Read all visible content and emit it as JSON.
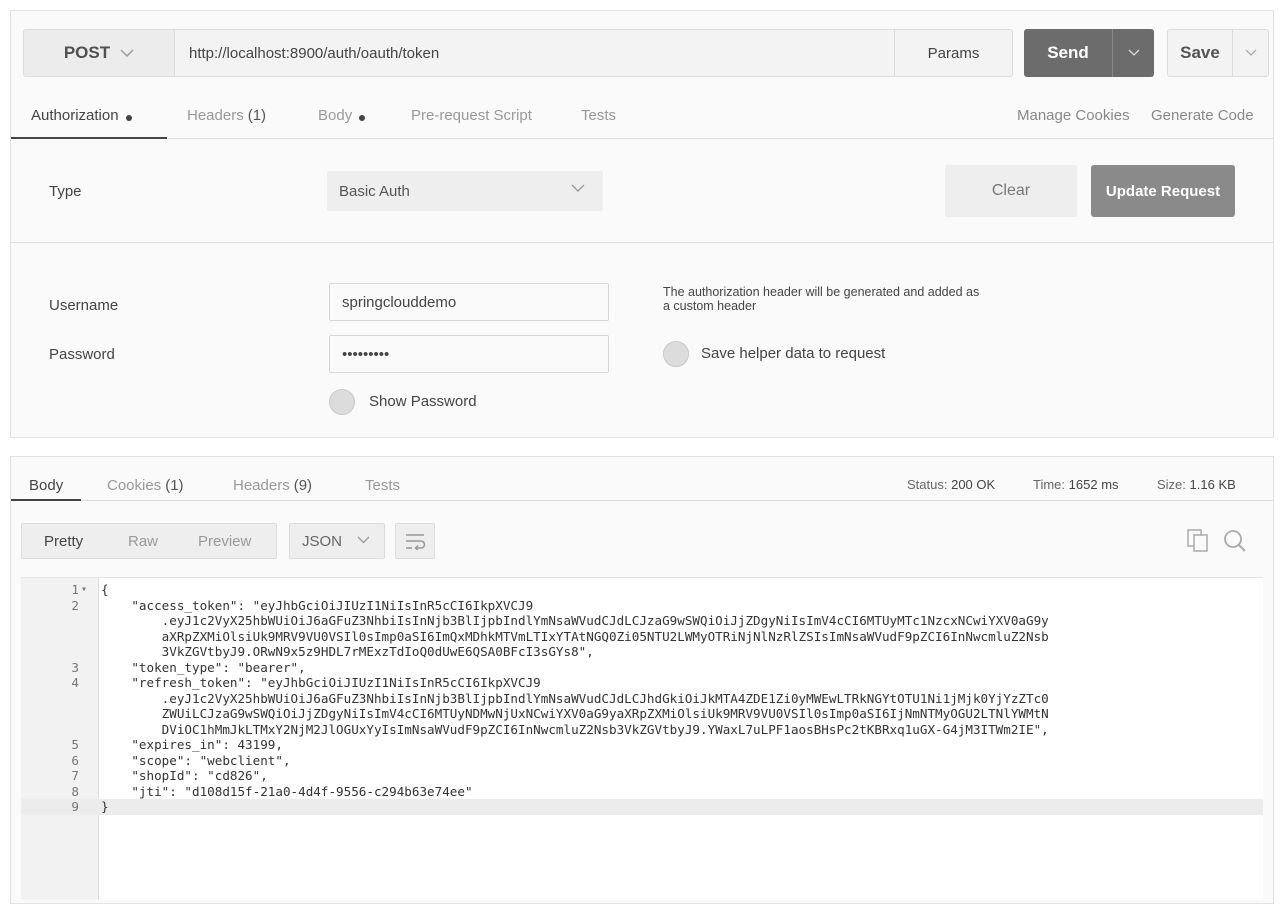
{
  "request": {
    "method": "POST",
    "url": "http://localhost:8900/auth/oauth/token",
    "params_label": "Params",
    "send_label": "Send",
    "save_label": "Save"
  },
  "request_tabs": [
    {
      "label": "Authorization",
      "count": "",
      "dot": true,
      "active": true
    },
    {
      "label": "Headers",
      "count": "(1)",
      "dot": false,
      "active": false
    },
    {
      "label": "Body",
      "count": "",
      "dot": true,
      "active": false
    },
    {
      "label": "Pre-request Script",
      "count": "",
      "dot": false,
      "active": false
    },
    {
      "label": "Tests",
      "count": "",
      "dot": false,
      "active": false
    }
  ],
  "links": {
    "manage_cookies": "Manage Cookies",
    "generate_code": "Generate Code"
  },
  "auth": {
    "type_label": "Type",
    "type_value": "Basic Auth",
    "clear_label": "Clear",
    "update_label": "Update Request",
    "username_label": "Username",
    "username_value": "springclouddemo",
    "password_label": "Password",
    "password_value": "•••••••••",
    "show_password_label": "Show Password",
    "helper_text": "The authorization header will be generated and added as a custom header",
    "save_helper_label": "Save helper data to request"
  },
  "response_tabs": [
    {
      "label": "Body",
      "count": "",
      "active": true
    },
    {
      "label": "Cookies",
      "count": "(1)",
      "active": false
    },
    {
      "label": "Headers",
      "count": "(9)",
      "active": false
    },
    {
      "label": "Tests",
      "count": "",
      "active": false
    }
  ],
  "status": {
    "status_label": "Status:",
    "status_value": "200 OK",
    "time_label": "Time:",
    "time_value": "1652 ms",
    "size_label": "Size:",
    "size_value": "1.16 KB"
  },
  "view_modes": [
    "Pretty",
    "Raw",
    "Preview"
  ],
  "format": "JSON",
  "code_lines": [
    {
      "num": "1",
      "fold": true,
      "text": "{"
    },
    {
      "num": "2",
      "fold": false,
      "text": "    \"access_token\": \"eyJhbGciOiJIUzI1NiIsInR5cCI6IkpXVCJ9"
    },
    {
      "num": "",
      "fold": false,
      "text": "        .eyJ1c2VyX25hbWUiOiJ6aGFuZ3NhbiIsInNjb3BlIjpbIndlYmNsaWVudCJdLCJzaG9wSWQiOiJjZDgyNiIsImV4cCI6MTUyMTc1NzcxNCwiYXV0aG9y"
    },
    {
      "num": "",
      "fold": false,
      "text": "        aXRpZXMiOlsiUk9MRV9VU0VSIl0sImp0aSI6ImQxMDhkMTVmLTIxYTAtNGQ0Zi05NTU2LWMyOTRiNjNlNzRlZSIsImNsaWVudF9pZCI6InNwcmluZ2Nsb"
    },
    {
      "num": "",
      "fold": false,
      "text": "        3VkZGVtbyJ9.ORwN9x5z9HDL7rMExzTdIoQ0dUwE6QSA0BFcI3sGYs8\","
    },
    {
      "num": "3",
      "fold": false,
      "text": "    \"token_type\": \"bearer\","
    },
    {
      "num": "4",
      "fold": false,
      "text": "    \"refresh_token\": \"eyJhbGciOiJIUzI1NiIsInR5cCI6IkpXVCJ9"
    },
    {
      "num": "",
      "fold": false,
      "text": "        .eyJ1c2VyX25hbWUiOiJ6aGFuZ3NhbiIsInNjb3BlIjpbIndlYmNsaWVudCJdLCJhdGkiOiJkMTA4ZDE1Zi0yMWEwLTRkNGYtOTU1Ni1jMjk0YjYzZTc0"
    },
    {
      "num": "",
      "fold": false,
      "text": "        ZWUiLCJzaG9wSWQiOiJjZDgyNiIsImV4cCI6MTUyNDMwNjUxNCwiYXV0aG9yaXRpZXMiOlsiUk9MRV9VU0VSIl0sImp0aSI6IjNmNTMyOGU2LTNlYWMtN"
    },
    {
      "num": "",
      "fold": false,
      "text": "        DViOC1hMmJkLTMxY2NjM2JlOGUxYyIsImNsaWVudF9pZCI6InNwcmluZ2Nsb3VkZGVtbyJ9.YWaxL7uLPF1aosBHsPc2tKBRxq1uGX-G4jM3ITWm2IE\","
    },
    {
      "num": "5",
      "fold": false,
      "text": "    \"expires_in\": 43199,"
    },
    {
      "num": "6",
      "fold": false,
      "text": "    \"scope\": \"webclient\","
    },
    {
      "num": "7",
      "fold": false,
      "text": "    \"shopId\": \"cd826\","
    },
    {
      "num": "8",
      "fold": false,
      "text": "    \"jti\": \"d108d15f-21a0-4d4f-9556-c294b63e74ee\""
    },
    {
      "num": "9",
      "fold": false,
      "text": "}"
    }
  ],
  "icons": {
    "method_chevron": "chevron-down-icon",
    "wrap": "word-wrap-icon",
    "copy": "copy-icon",
    "search": "search-icon"
  }
}
